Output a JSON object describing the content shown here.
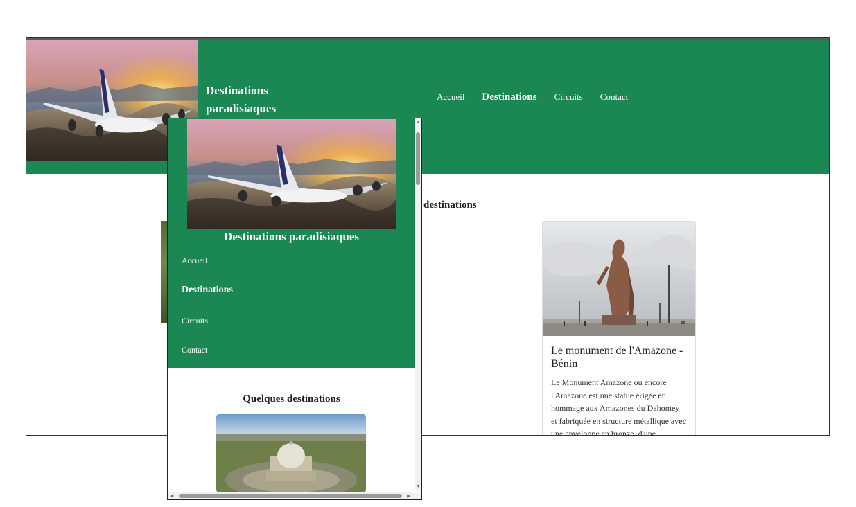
{
  "desktop": {
    "brand": "Destinations paradisiaques",
    "nav": [
      "Accueil",
      "Destinations",
      "Circuits",
      "Contact"
    ],
    "active_nav": "Destinations",
    "section_title_partial": "destinations",
    "card": {
      "title": "Le monument de l'Amazone - Bénin",
      "text": "Le Monument Amazone ou encore l'Amazone est une statue érigée en hommage aux Amazones du Dahomey et fabriquée en structure métallique avec une enveloppe en bronze, d'une"
    }
  },
  "mobile": {
    "brand": "Destinations paradisiaques",
    "nav": [
      "Accueil",
      "Destinations",
      "Circuits",
      "Contact"
    ],
    "active_nav": "Destinations",
    "section_title": "Quelques destinations"
  },
  "colors": {
    "header_green": "#1b8753",
    "text_white": "#ffffff"
  },
  "icons": [
    "airplane-photo",
    "amazone-statue-photo",
    "basilica-photo",
    "scroll-arrow-up-icon",
    "scroll-arrow-down-icon",
    "scroll-arrow-left-icon",
    "scroll-arrow-right-icon"
  ]
}
